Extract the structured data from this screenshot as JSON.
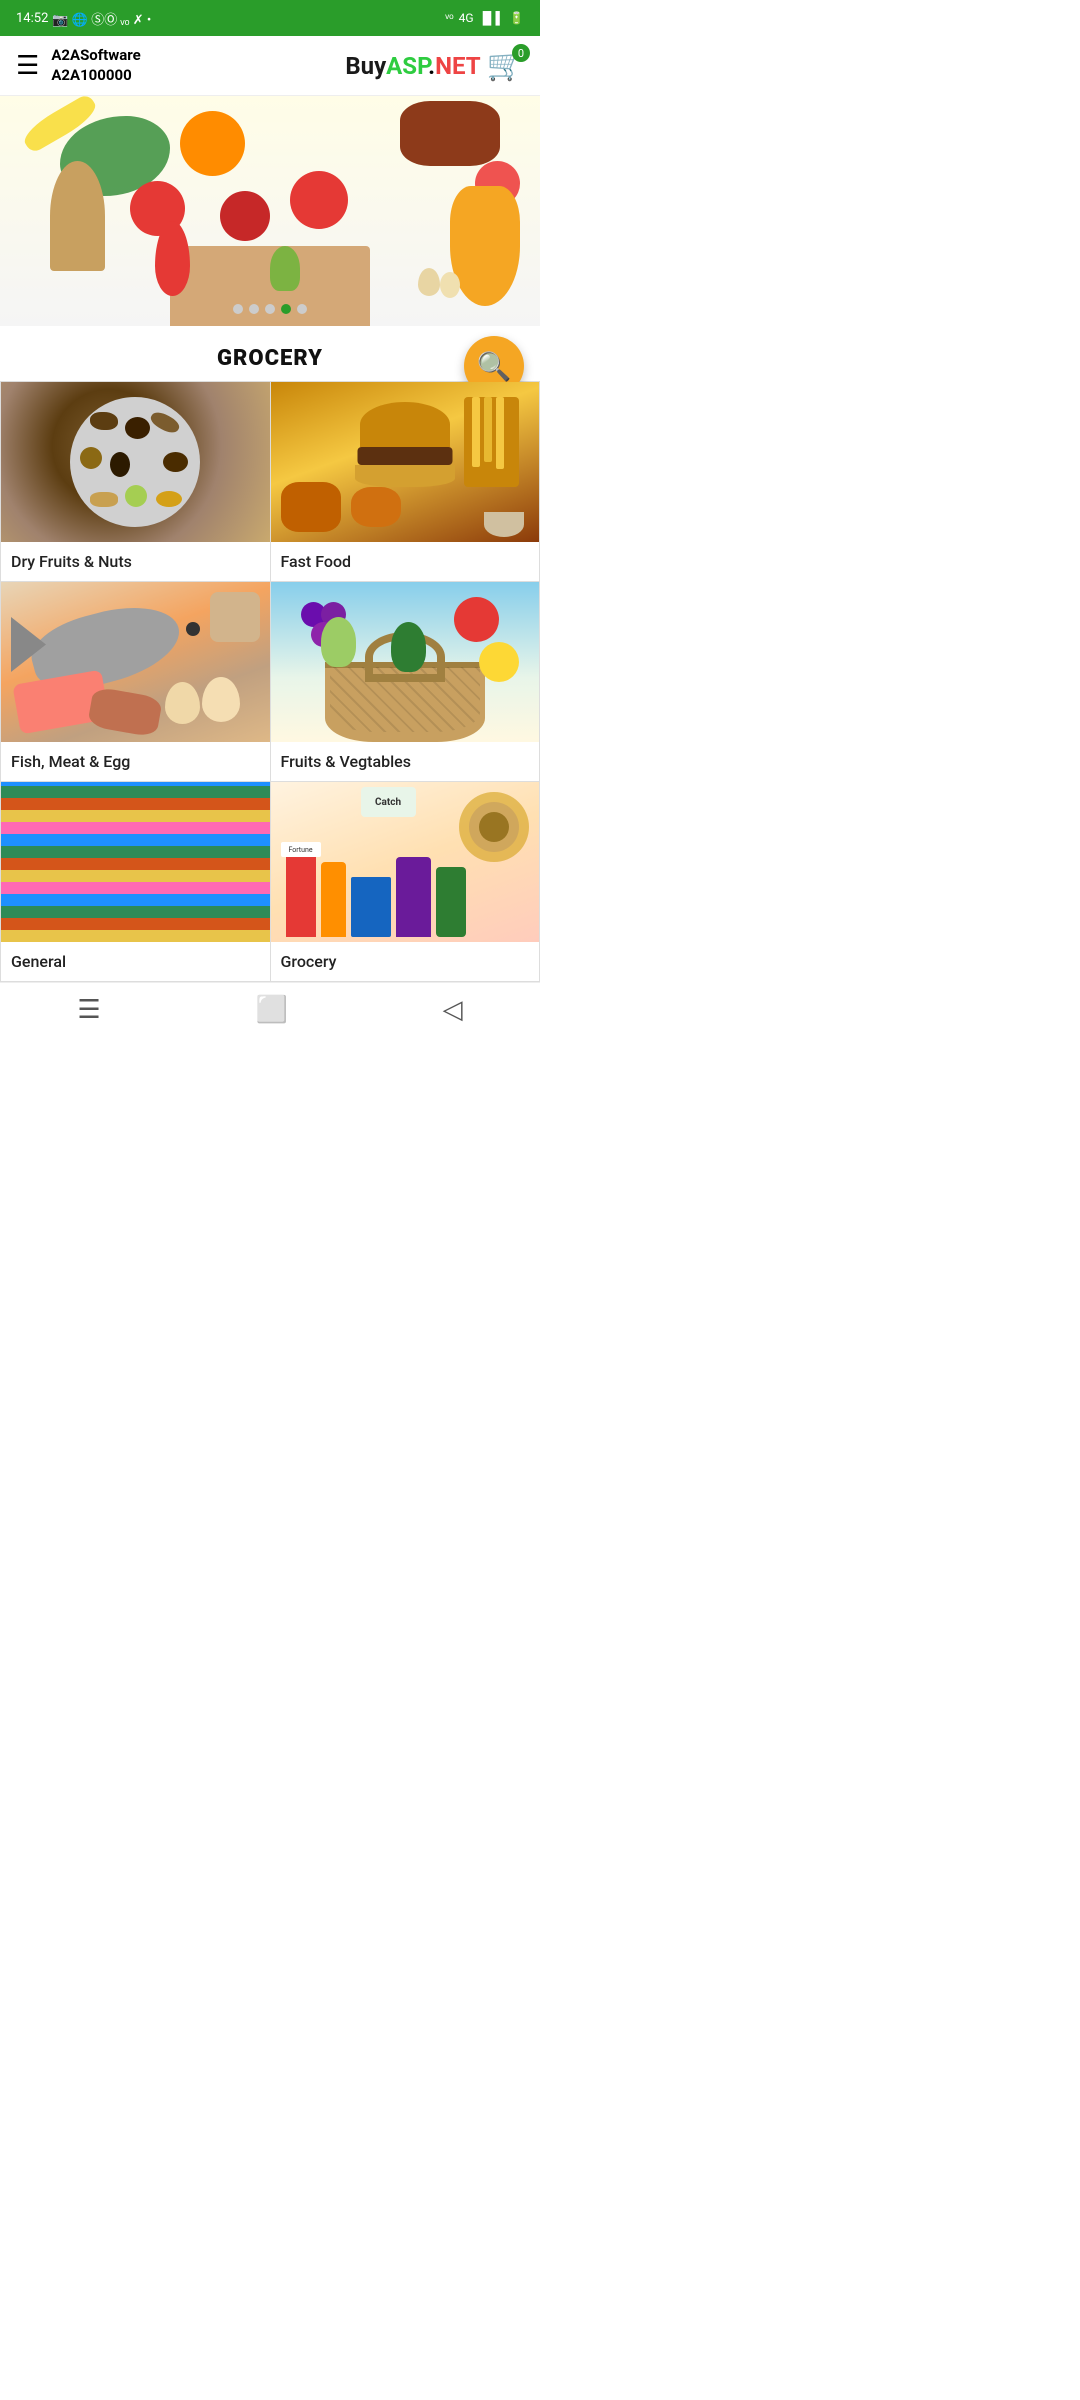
{
  "status": {
    "time": "14:52",
    "battery": "🔋",
    "network": "4G"
  },
  "header": {
    "menu_label": "☰",
    "user_name": "A2ASoftware",
    "user_id": "A2A100000",
    "logo_buy": "Buy",
    "logo_asp": "ASP",
    "logo_dot": ".",
    "logo_net": "NET",
    "cart_count": "0"
  },
  "banner": {
    "dots": [
      1,
      2,
      3,
      4,
      5
    ],
    "active_dot": 3
  },
  "main": {
    "section_title": "GROCERY",
    "search_fab_label": "🔍",
    "categories": [
      {
        "id": "dry-fruits",
        "label": "Dry Fruits & Nuts",
        "image_type": "dry-fruits"
      },
      {
        "id": "fast-food",
        "label": "Fast Food",
        "image_type": "fast-food"
      },
      {
        "id": "fish-meat",
        "label": "Fish, Meat & Egg",
        "image_type": "fish-meat"
      },
      {
        "id": "fruits-veg",
        "label": "Fruits & Vegtables",
        "image_type": "fruits-veg"
      },
      {
        "id": "general",
        "label": "General",
        "image_type": "general"
      },
      {
        "id": "grocery",
        "label": "Grocery",
        "image_type": "grocery"
      }
    ]
  },
  "bottom_nav": {
    "menu_icon": "☰",
    "home_icon": "⬜",
    "back_icon": "◁"
  }
}
